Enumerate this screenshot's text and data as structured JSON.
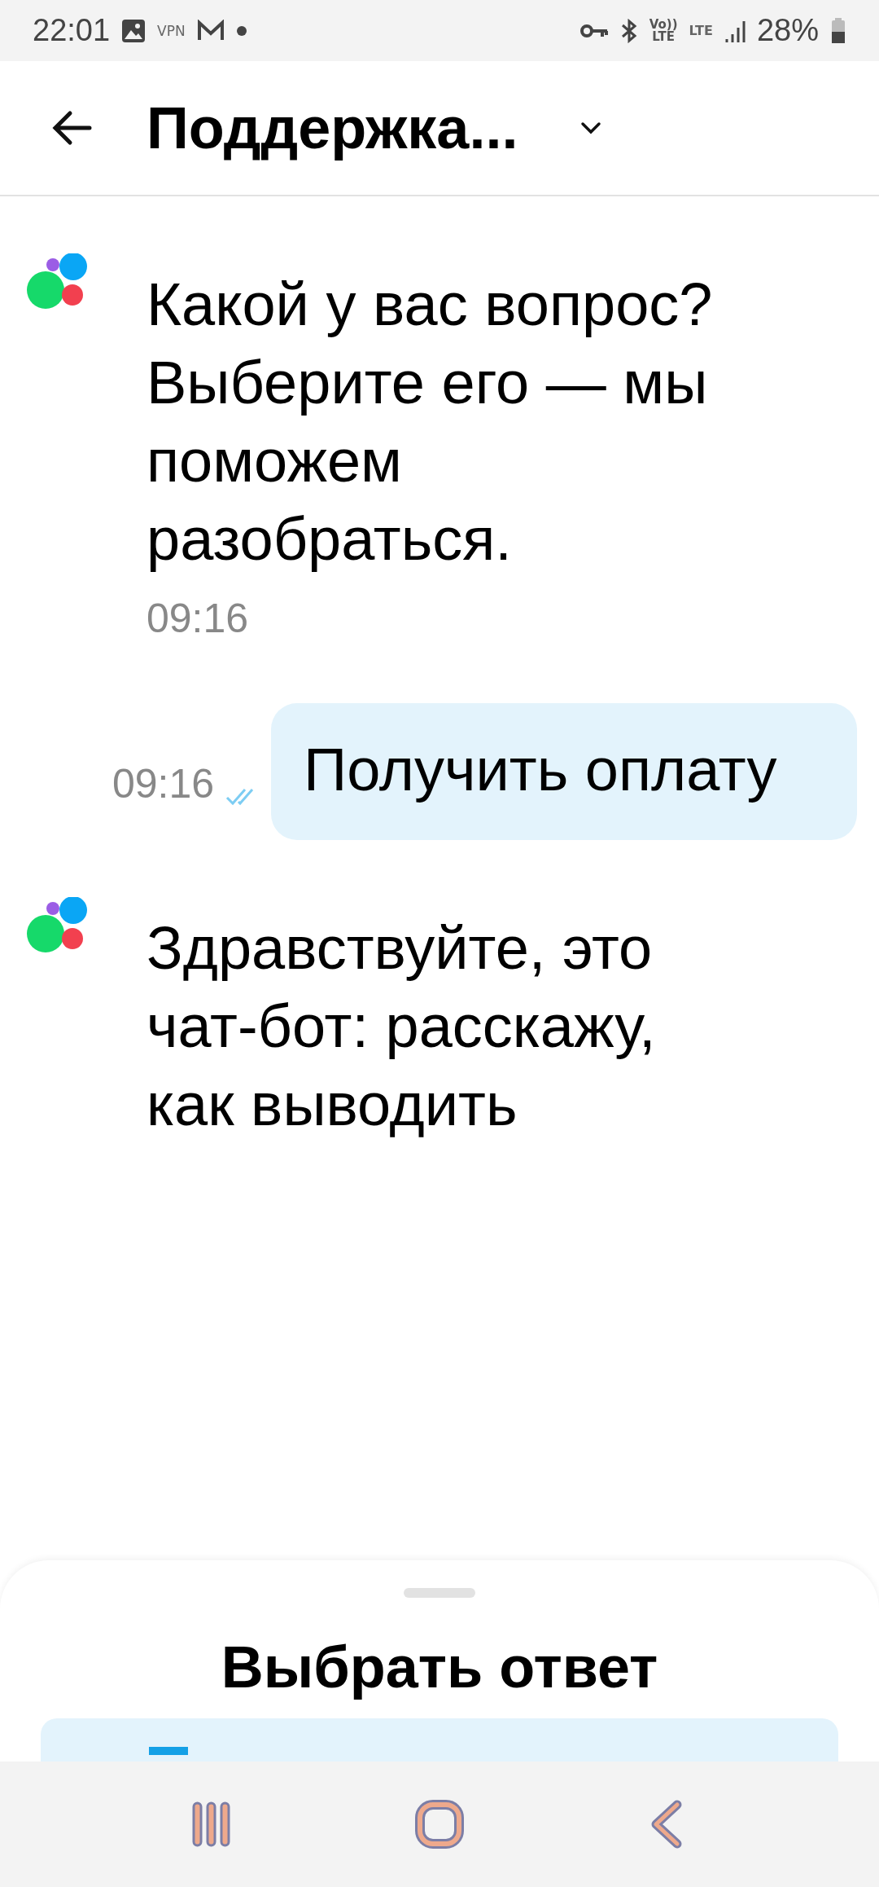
{
  "status_bar": {
    "time": "22:01",
    "vpn": "VPN",
    "volte_top": "Vo))",
    "volte_bottom": "LTE",
    "lte": "LTE",
    "battery": "28%"
  },
  "header": {
    "title": "Поддержка..."
  },
  "messages": [
    {
      "kind": "bot",
      "text": "Какой у вас вопрос? Выберите его — мы поможем разобраться.",
      "time": "09:16"
    },
    {
      "kind": "user",
      "text": "Получить оплату",
      "time": "09:16",
      "read": true
    },
    {
      "kind": "bot",
      "text": "Здравствуйте, это чат-бот: расскажу, как выводить"
    }
  ],
  "sheet": {
    "title": "Выбрать ответ"
  }
}
